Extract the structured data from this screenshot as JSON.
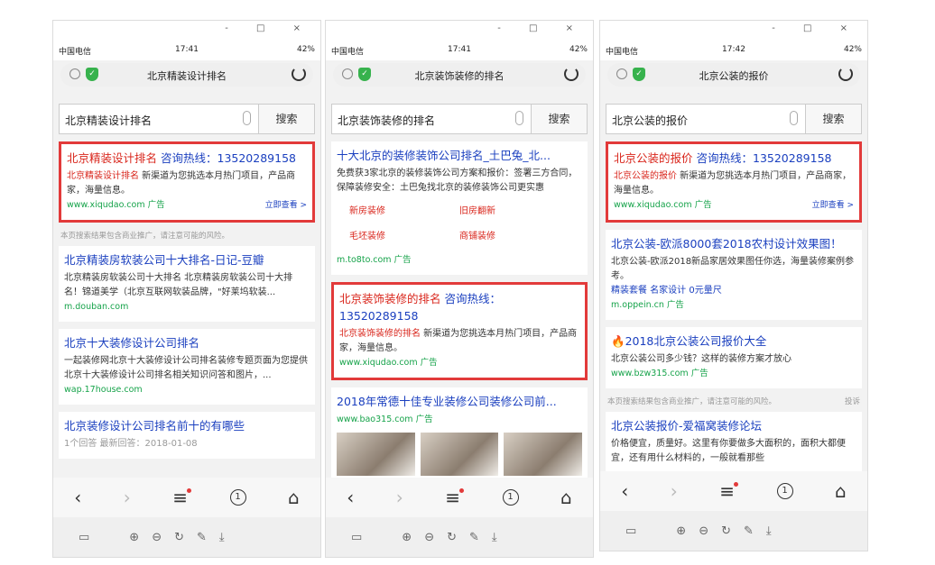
{
  "window": {
    "controls": "-  □  ×"
  },
  "phones": [
    {
      "status": {
        "carrier": "中国电信",
        "time": "17:41",
        "battery": "42%"
      },
      "addr": "北京精装设计排名",
      "search": {
        "query": "北京精装设计排名",
        "button": "搜索"
      },
      "ad": {
        "title_a": "北京精装设计排名",
        "title_b": " 咨询热线：13520289158",
        "desc_a": "北京精装设计排名",
        "desc_b": " 新渠道为您挑选本月热门项目，产品商家，海量信息。",
        "url": "www.xiqudao.com 广告",
        "more": "立即查看 >"
      },
      "note": "本页搜索结果包含商业推广，请注意可能的风险。",
      "results": [
        {
          "title": "北京精装房软装公司十大排名-日记-豆瓣",
          "desc": "北京精装房软装公司十大排名 北京精装房软装公司十大排名！锦道美学（北京互联网软装品牌，\"好莱坞软装...",
          "url": "m.douban.com"
        },
        {
          "title": "北京十大装修设计公司排名",
          "desc": "一起装修网北京十大装修设计公司排名装修专题页面为您提供北京十大装修设计公司排名相关知识问答和图片，...",
          "url": "wap.17house.com"
        },
        {
          "title": "北京装修设计公司排名前十的有哪些",
          "desc": "1个回答 最新回答：2018-01-08",
          "url": ""
        }
      ]
    },
    {
      "status": {
        "carrier": "中国电信",
        "time": "17:41",
        "battery": "42%"
      },
      "addr": "北京装饰装修的排名",
      "search": {
        "query": "北京装饰装修的排名",
        "button": "搜索"
      },
      "top": {
        "title": "十大北京的装修装饰公司排名_土巴兔_北...",
        "desc": "免费获3家北京的装修装饰公司方案和报价：签署三方合同，保障装修安全：土巴兔找北京的装修装饰公司更实惠",
        "links": [
          "新房装修",
          "旧房翻新",
          "毛坯装修",
          "商铺装修"
        ],
        "url": "m.to8to.com 广告"
      },
      "ad": {
        "title_a": "北京装饰装修的排名",
        "title_b": " 咨询热线：13520289158",
        "desc_a": "北京装饰装修的排名",
        "desc_b": " 新渠道为您挑选本月热门项目，产品商家，海量信息。",
        "url": "www.xiqudao.com 广告"
      },
      "bottom": {
        "title": "2018年常德十佳专业装修公司装修公司前...",
        "url": "www.bao315.com 广告"
      }
    },
    {
      "status": {
        "carrier": "中国电信",
        "time": "17:42",
        "battery": "42%"
      },
      "addr": "北京公装的报价",
      "search": {
        "query": "北京公装的报价",
        "button": "搜索"
      },
      "ad": {
        "title_a": "北京公装的报价",
        "title_b": " 咨询热线：13520289158",
        "desc_a": "北京公装的报价",
        "desc_b": " 新渠道为您挑选本月热门项目，产品商家，海量信息。",
        "url": "www.xiqudao.com 广告",
        "more": "立即查看 >"
      },
      "r1": {
        "title": "北京公装-欧派8000套2018农村设计效果图！",
        "desc": "北京公装-欧派2018新品家居效果图任你选，海量装修案例参考。",
        "links": "精装套餐  名家设计  0元量尺",
        "url": "m.oppein.cn 广告"
      },
      "r2": {
        "title": "🔥2018北京公装公司报价大全",
        "desc": "北京公装公司多少钱？这样的装修方案才放心",
        "url": "www.bzw315.com 广告"
      },
      "note": "本页搜索结果包含商业推广，请注意可能的风险。",
      "note_right": "投诉",
      "r3": {
        "title": "北京公装报价-爱福窝装修论坛",
        "desc": "价格便宜，质量好。这里有你要做多大面积的，面积大都便宜，还有用什么材料的，一般就看那些"
      }
    }
  ],
  "nav": {
    "back": "‹",
    "fwd": "›",
    "menu": "≡",
    "tabs": "1",
    "home": "⌂"
  },
  "tools": {
    "a": "▭",
    "b": "⊕",
    "c": "⊖",
    "d": "↻",
    "e": "✎",
    "f": "⤓"
  }
}
